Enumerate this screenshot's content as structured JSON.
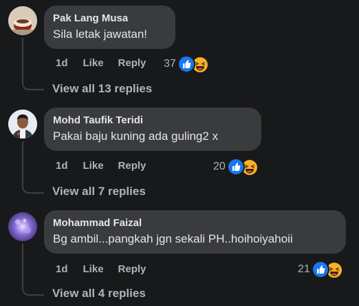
{
  "comments": [
    {
      "author": "Pak Lang Musa",
      "text": "Sila letak jawatan!",
      "time": "1d",
      "like_label": "Like",
      "reply_label": "Reply",
      "reaction_count": "37",
      "reactions": [
        "like-icon",
        "haha-icon"
      ],
      "view_replies": "View all 13 replies"
    },
    {
      "author": "Mohd Taufik Teridi",
      "text": "Pakai baju kuning ada guling2 x",
      "time": "1d",
      "like_label": "Like",
      "reply_label": "Reply",
      "reaction_count": "20",
      "reactions": [
        "like-icon",
        "haha-icon"
      ],
      "view_replies": "View all 7 replies"
    },
    {
      "author": "Mohammad Faizal",
      "text": "Bg ambil...pangkah jgn sekali PH..hoihoiyahoii",
      "time": "1d",
      "like_label": "Like",
      "reply_label": "Reply",
      "reaction_count": "21",
      "reactions": [
        "like-icon",
        "haha-icon"
      ],
      "view_replies": "View all 4 replies"
    }
  ],
  "colors": {
    "background": "#18191a",
    "bubble": "#3a3b3c",
    "like_blue": "#1877f2",
    "haha_yellow": "#f7b125",
    "secondary_text": "#b0b3b8"
  }
}
